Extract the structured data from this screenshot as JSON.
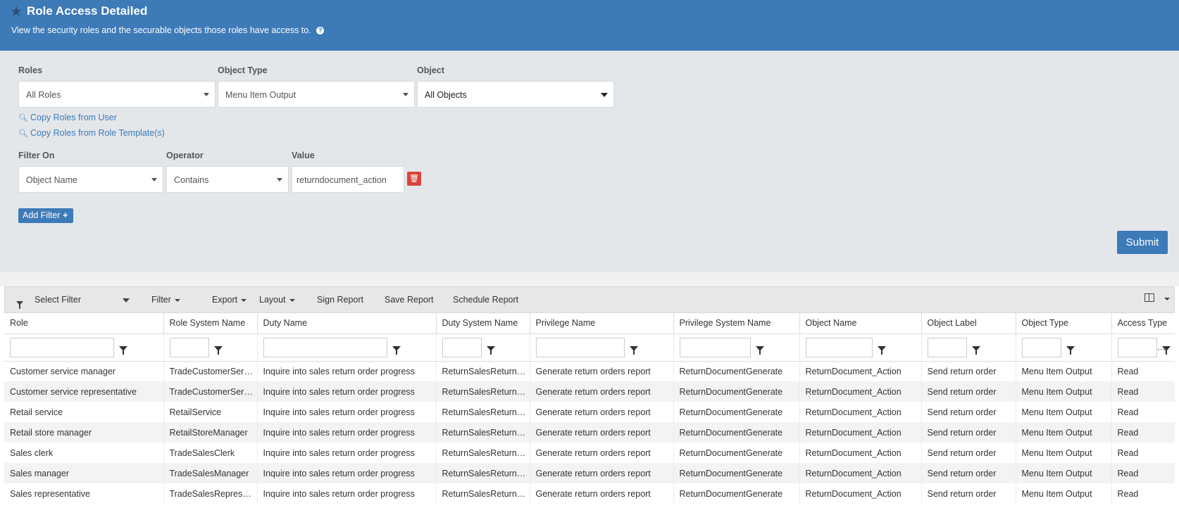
{
  "header": {
    "title": "Role Access Detailed",
    "subtitle": "View the security roles and the securable objects those roles have access to.",
    "help_icon": "?"
  },
  "params": {
    "roles": {
      "label": "Roles",
      "value": "All Roles"
    },
    "object_type": {
      "label": "Object Type",
      "value": "Menu Item Output"
    },
    "object": {
      "label": "Object",
      "value": "All Objects"
    },
    "copy_from_user": "Copy Roles from User",
    "copy_from_template": "Copy Roles from Role Template(s)",
    "filter_on": {
      "label": "Filter On",
      "value": "Object Name"
    },
    "operator": {
      "label": "Operator",
      "value": "Contains"
    },
    "value": {
      "label": "Value",
      "value": "returndocument_action"
    },
    "add_filter": "Add Filter",
    "submit": "Submit"
  },
  "toolbar": {
    "select_filter": "Select Filter",
    "filter": "Filter",
    "export": "Export",
    "layout": "Layout",
    "sign_report": "Sign Report",
    "save_report": "Save Report",
    "schedule_report": "Schedule Report"
  },
  "table": {
    "columns": [
      "Role",
      "Role System Name",
      "Duty Name",
      "Duty System Name",
      "Privilege Name",
      "Privilege System Name",
      "Object Name",
      "Object Label",
      "Object Type",
      "Access Type"
    ],
    "rows": [
      [
        "Customer service manager",
        "TradeCustomerServiceManager",
        "Inquire into sales return order progress",
        "ReturnSalesReturnOrderProgressInquire",
        "Generate return orders report",
        "ReturnDocumentGenerate",
        "ReturnDocument_Action",
        "Send return order",
        "Menu Item Output",
        "Read"
      ],
      [
        "Customer service representative",
        "TradeCustomerServiceRepresentative",
        "Inquire into sales return order progress",
        "ReturnSalesReturnOrderProgressInquire",
        "Generate return orders report",
        "ReturnDocumentGenerate",
        "ReturnDocument_Action",
        "Send return order",
        "Menu Item Output",
        "Read"
      ],
      [
        "Retail service",
        "RetailService",
        "Inquire into sales return order progress",
        "ReturnSalesReturnOrderProgressInquire",
        "Generate return orders report",
        "ReturnDocumentGenerate",
        "ReturnDocument_Action",
        "Send return order",
        "Menu Item Output",
        "Read"
      ],
      [
        "Retail store manager",
        "RetailStoreManager",
        "Inquire into sales return order progress",
        "ReturnSalesReturnOrderProgressInquire",
        "Generate return orders report",
        "ReturnDocumentGenerate",
        "ReturnDocument_Action",
        "Send return order",
        "Menu Item Output",
        "Read"
      ],
      [
        "Sales clerk",
        "TradeSalesClerk",
        "Inquire into sales return order progress",
        "ReturnSalesReturnOrderProgressInquire",
        "Generate return orders report",
        "ReturnDocumentGenerate",
        "ReturnDocument_Action",
        "Send return order",
        "Menu Item Output",
        "Read"
      ],
      [
        "Sales manager",
        "TradeSalesManager",
        "Inquire into sales return order progress",
        "ReturnSalesReturnOrderProgressInquire",
        "Generate return orders report",
        "ReturnDocumentGenerate",
        "ReturnDocument_Action",
        "Send return order",
        "Menu Item Output",
        "Read"
      ],
      [
        "Sales representative",
        "TradeSalesRepresentative",
        "Inquire into sales return order progress",
        "ReturnSalesReturnOrderProgressInquire",
        "Generate return orders report",
        "ReturnDocumentGenerate",
        "ReturnDocument_Action",
        "Send return order",
        "Menu Item Output",
        "Read"
      ]
    ]
  },
  "colors": {
    "header_bg": "#3d7ab8",
    "panel_bg": "#e4e7ea",
    "accent": "#3d7ab8",
    "danger": "#d9453b"
  }
}
